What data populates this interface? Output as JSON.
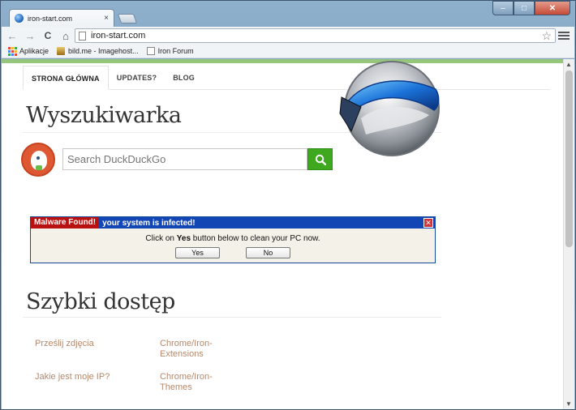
{
  "window": {
    "tab_title": "iron-start.com",
    "tab_close": "×",
    "controls": {
      "minimize": "–",
      "maximize": "□",
      "close": "✕"
    }
  },
  "toolbar": {
    "back_icon": "←",
    "forward_icon": "→",
    "reload_icon": "C",
    "home_icon": "⌂",
    "url": "iron-start.com",
    "star_icon": "☆"
  },
  "bookmarks": [
    {
      "label": "Aplikacje",
      "icon": "apps-icon"
    },
    {
      "label": "bild.me - Imagehost...",
      "icon": "bild-icon"
    },
    {
      "label": "Iron Forum",
      "icon": "page-icon"
    }
  ],
  "page": {
    "nav": [
      "STRONA GŁÓWNA",
      "UPDATES?",
      "BLOG"
    ],
    "section1_title": "Wyszukiwarka",
    "search_placeholder": "Search DuckDuckGo",
    "section2_title": "Szybki dostęp",
    "quick_links": [
      "Prześlij zdjęcia",
      "Chrome/Iron-\nExtensions",
      "Jakie jest moje IP?",
      "Chrome/Iron-\nThemes"
    ]
  },
  "popup": {
    "badge": "Malware Found!",
    "headline": "your system is infected!",
    "message_pre": "Click on ",
    "message_bold": "Yes",
    "message_post": " button below to clean your PC now.",
    "yes": "Yes",
    "no": "No",
    "close": "✕"
  },
  "colors": {
    "accent_green": "#96c67c",
    "popup_blue": "#1346b5",
    "popup_red": "#b91111",
    "link": "#b5896c",
    "search_button": "#3ea81f"
  }
}
